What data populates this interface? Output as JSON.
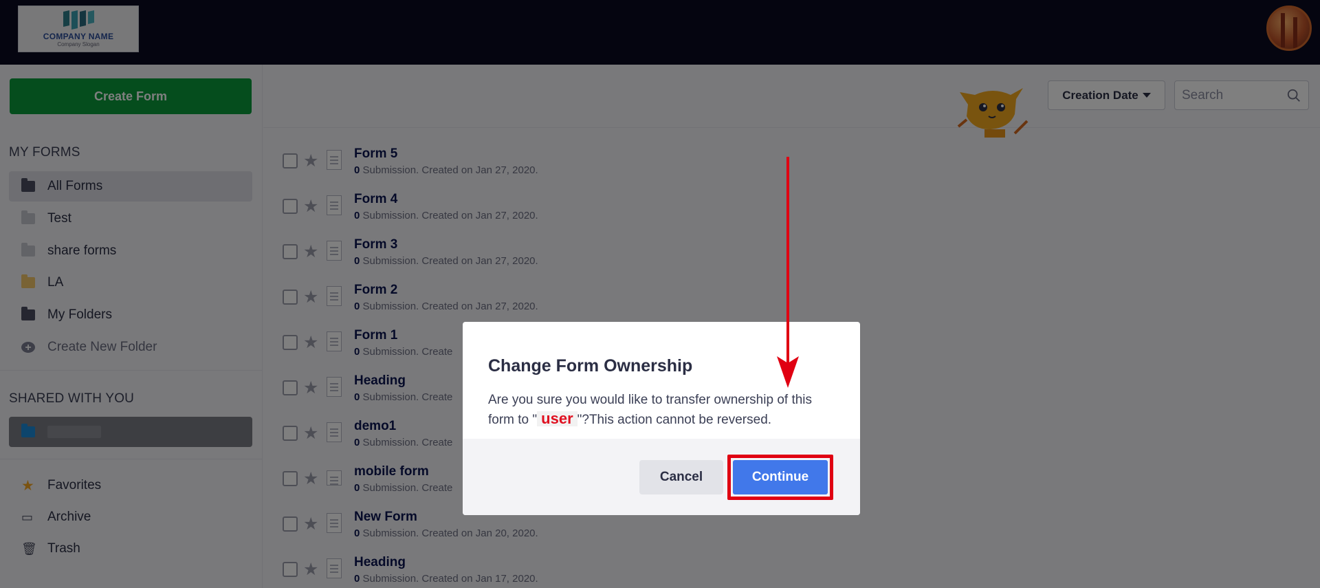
{
  "header": {
    "logo_name": "COMPANY NAME",
    "logo_slogan": "Company Slogan"
  },
  "sidebar": {
    "create_label": "Create Form",
    "my_forms_title": "MY FORMS",
    "items": [
      {
        "label": "All Forms",
        "icon": "folder-icon"
      },
      {
        "label": "Test",
        "icon": "folder-icon"
      },
      {
        "label": "share forms",
        "icon": "folder-icon"
      },
      {
        "label": "LA",
        "icon": "folder-icon"
      },
      {
        "label": "My Folders",
        "icon": "folder-icon"
      },
      {
        "label": "Create New Folder",
        "icon": "plus-circle-icon"
      }
    ],
    "shared_title": "SHARED WITH YOU",
    "bottom": [
      {
        "label": "Favorites",
        "icon": "star-icon"
      },
      {
        "label": "Archive",
        "icon": "archive-icon"
      },
      {
        "label": "Trash",
        "icon": "trash-icon"
      }
    ]
  },
  "toolbar": {
    "sort_label": "Creation Date",
    "search_placeholder": "Search"
  },
  "forms": [
    {
      "title": "Form 5",
      "count": "0",
      "meta": " Submission. Created on Jan 27, 2020."
    },
    {
      "title": "Form 4",
      "count": "0",
      "meta": " Submission. Created on Jan 27, 2020."
    },
    {
      "title": "Form 3",
      "count": "0",
      "meta": " Submission. Created on Jan 27, 2020."
    },
    {
      "title": "Form 2",
      "count": "0",
      "meta": " Submission. Created on Jan 27, 2020."
    },
    {
      "title": "Form 1",
      "count": "0",
      "meta": " Submission. Create"
    },
    {
      "title": "Heading",
      "count": "0",
      "meta": " Submission. Create"
    },
    {
      "title": "demo1",
      "count": "0",
      "meta": " Submission. Create"
    },
    {
      "title": "mobile form",
      "count": "0",
      "meta": " Submission. Create"
    },
    {
      "title": "New Form",
      "count": "0",
      "meta": " Submission. Created on Jan 20, 2020."
    },
    {
      "title": "Heading",
      "count": "0",
      "meta": " Submission. Created on Jan 17, 2020."
    }
  ],
  "modal": {
    "title": "Change Form Ownership",
    "body_before": "Are you sure you would like to transfer ownership of this form to \"",
    "user": "user",
    "body_after": "\"?This action cannot be reversed.",
    "cancel_label": "Cancel",
    "continue_label": "Continue"
  },
  "colors": {
    "create_button": "#0a9b3a",
    "continue_button": "#4178ea",
    "highlight": "#e00012"
  }
}
